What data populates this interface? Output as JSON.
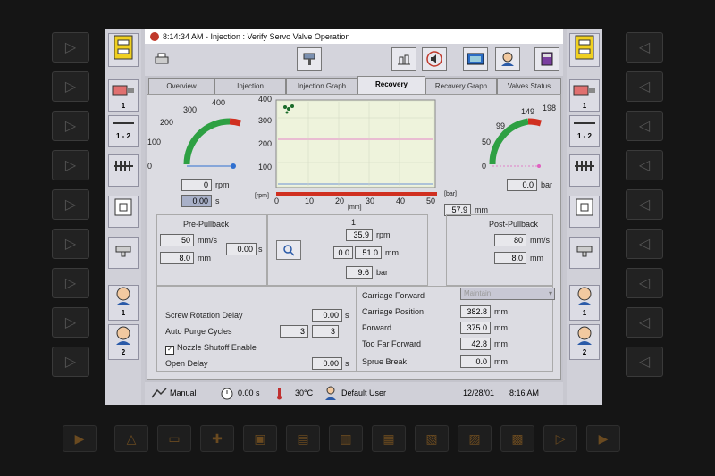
{
  "title": "8:14:34 AM - Injection : Verify Servo Valve Operation",
  "tabs": [
    "Overview",
    "Injection",
    "Injection Graph",
    "Recovery",
    "Recovery Graph",
    "Valves Status"
  ],
  "active_tab": "Recovery",
  "rpm_gauge": {
    "ticks": [
      "0",
      "100",
      "200",
      "300",
      "400"
    ],
    "value": "0",
    "unit": "rpm",
    "time": "0.00",
    "time_unit": "s"
  },
  "chart": {
    "y_ticks": [
      "100",
      "200",
      "300",
      "400"
    ],
    "x_ticks": [
      "0",
      "10",
      "20",
      "30",
      "40",
      "50"
    ],
    "y_unit": "[rpm]",
    "x_unit": "[mm]",
    "p_unit": "[bar]",
    "position": "57.9",
    "position_unit": "mm"
  },
  "bar_gauge": {
    "ticks": [
      "0",
      "50",
      "99",
      "149",
      "198"
    ],
    "value": "0.0",
    "unit": "bar"
  },
  "pre_pullback": {
    "title": "Pre-Pullback",
    "speed": "50",
    "speed_unit": "mm/s",
    "distance": "8.0",
    "distance_unit": "mm",
    "time": "0.00",
    "time_unit": "s"
  },
  "stage": {
    "number": "1",
    "rpm": "35.9",
    "rpm_unit": "rpm",
    "pos_a": "0.0",
    "pos_b": "51.0",
    "pos_unit": "mm",
    "pressure": "9.6",
    "pressure_unit": "bar"
  },
  "post_pullback": {
    "title": "Post-Pullback",
    "speed": "80",
    "speed_unit": "mm/s",
    "distance": "8.0",
    "distance_unit": "mm"
  },
  "settings": {
    "screw_delay_label": "Screw Rotation Delay",
    "screw_delay": "0.00",
    "screw_delay_unit": "s",
    "auto_purge_label": "Auto Purge Cycles",
    "auto_purge_a": "3",
    "auto_purge_b": "3",
    "nozzle_label": "Nozzle Shutoff Enable",
    "open_delay_label": "Open Delay",
    "open_delay": "0.00",
    "open_delay_unit": "s"
  },
  "carriage": {
    "forward_label": "Carriage Forward",
    "forward_select": "Maintain",
    "position_label": "Carriage Position",
    "position": "382.8",
    "position_unit": "mm",
    "fwd_label": "Forward",
    "fwd": "375.0",
    "fwd_unit": "mm",
    "toofar_label": "Too Far Forward",
    "toofar": "42.8",
    "toofar_unit": "mm",
    "sprue_label": "Sprue Break",
    "sprue": "0.0",
    "sprue_unit": "mm"
  },
  "status": {
    "mode": "Manual",
    "timer": "0.00 s",
    "temp": "30°C",
    "user": "Default User",
    "date": "12/28/01",
    "time": "8:16 AM"
  },
  "side_labels": {
    "l1": "1",
    "l2": "1 - 2",
    "l3": "1",
    "l4": "2",
    "r1": "1",
    "r2": "1 - 2",
    "r3": "1",
    "r4": "2"
  }
}
